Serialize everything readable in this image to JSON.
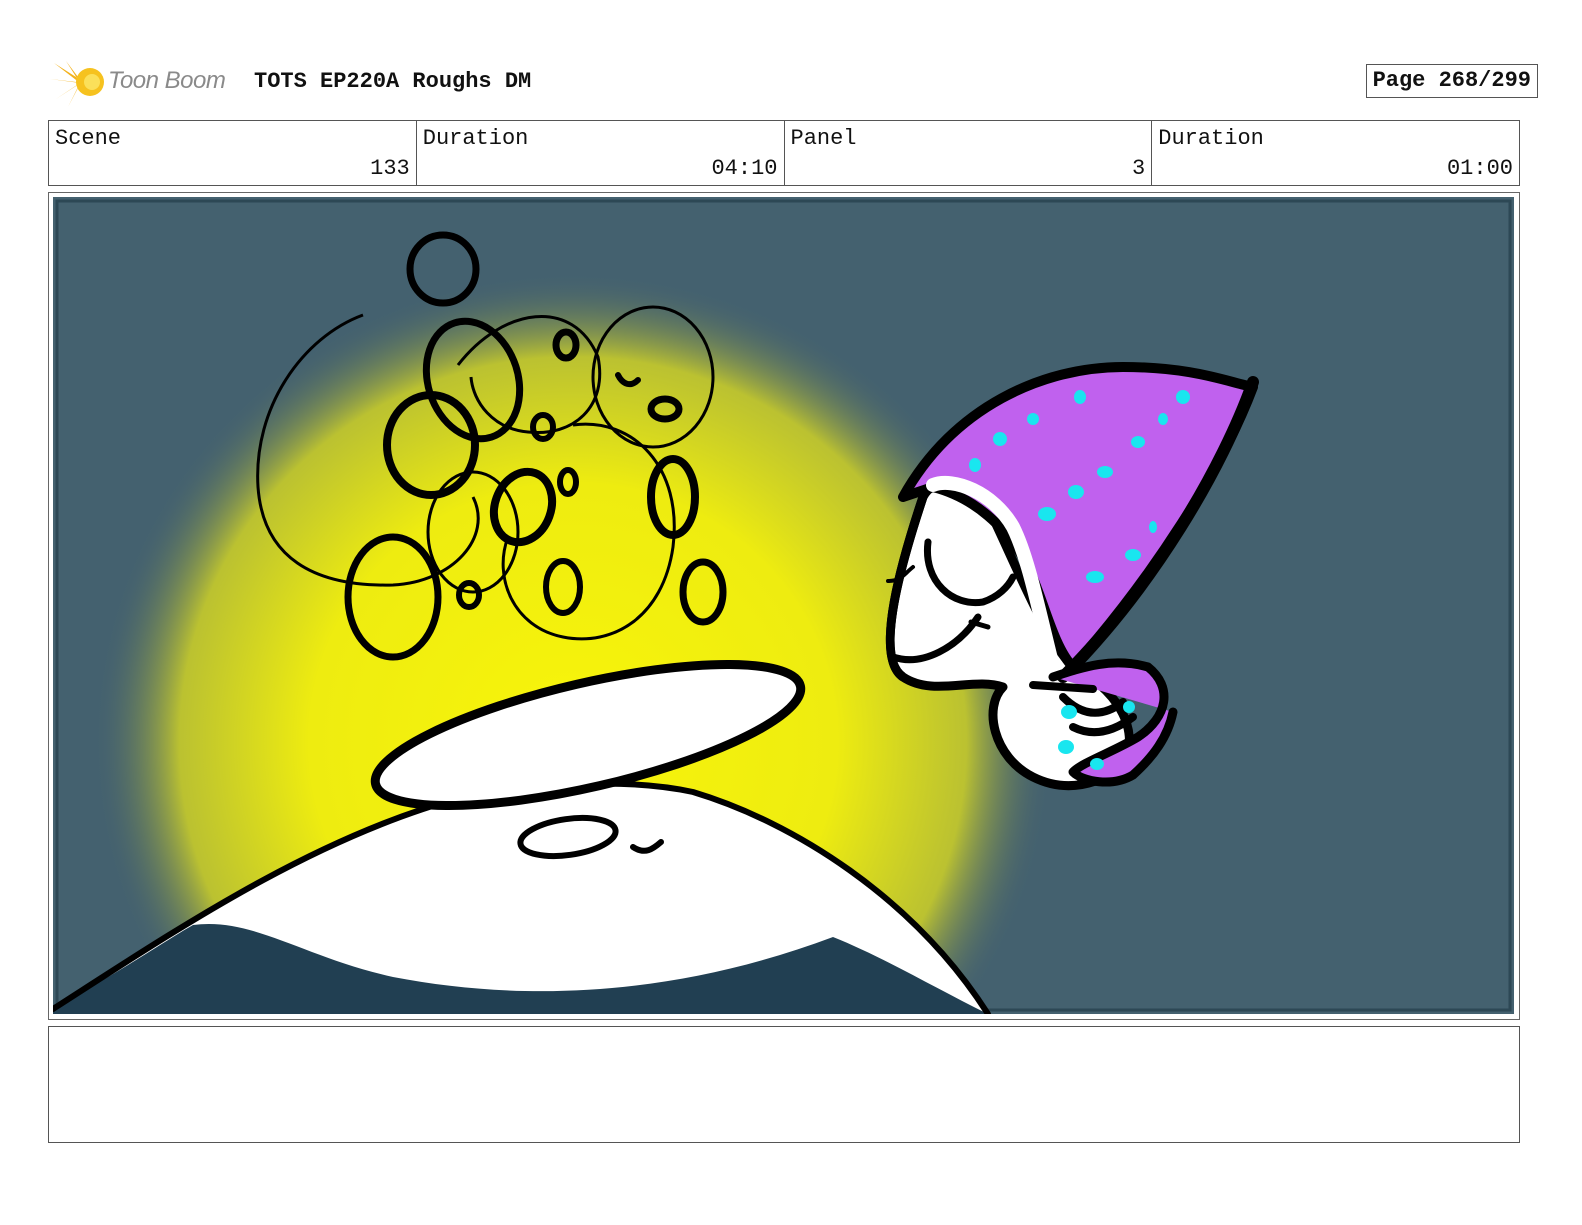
{
  "header": {
    "logo_text": "Toon Boom",
    "title": "TOTS EP220A Roughs DM",
    "page": "Page 268/299"
  },
  "info": {
    "scene_label": "Scene",
    "scene_value": "133",
    "scene_duration_label": "Duration",
    "scene_duration_value": "04:10",
    "panel_label": "Panel",
    "panel_value": "3",
    "panel_duration_label": "Duration",
    "panel_duration_value": "01:00"
  },
  "colors": {
    "background": "#44616f",
    "glow": "#f4f20d",
    "hill_dark": "#213f52",
    "hat": "#c061ee",
    "hat_dots": "#19e6ef",
    "outline": "#000000"
  },
  "notes": ""
}
